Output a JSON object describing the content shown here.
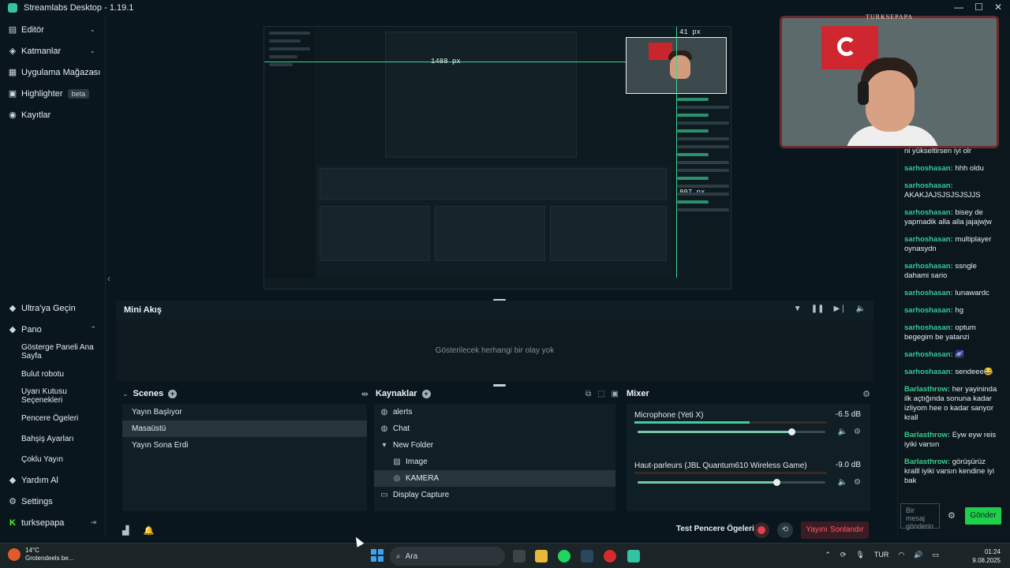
{
  "window": {
    "title": "Streamlabs Desktop - 1.19.1",
    "app_icon": "streamlabs-logo-icon",
    "controls": [
      "—",
      "☐",
      "✕"
    ]
  },
  "sidebar": {
    "top_items": [
      {
        "label": "Editör",
        "icon": "editor-icon",
        "expandable": true
      },
      {
        "label": "Katmanlar",
        "icon": "layers-icon",
        "expandable": true
      },
      {
        "label": "Uygulama Mağazası",
        "icon": "store-icon",
        "expandable": true
      },
      {
        "label": "Highlighter",
        "icon": "highlighter-icon",
        "badge": "beta"
      },
      {
        "label": "Kayıtlar",
        "icon": "record-icon"
      }
    ],
    "bottom_items": {
      "ultra": "Ultra'ya Geçin",
      "dashboard": "Pano",
      "dashboard_sub": [
        "Gösterge Paneli Ana Sayfa",
        "Bulut robotu",
        "Uyarı Kutusu Seçenekleri",
        "Pencere Ögeleri",
        "Bahşiş Ayarları",
        "Çoklu Yayın"
      ],
      "help": "Yardım Al",
      "settings": "Settings",
      "user": "turksepapa"
    }
  },
  "preview": {
    "width_label": "1488 px",
    "cam_label": "41 px",
    "chat_label": "807 px"
  },
  "mini_feed": {
    "title": "Mini Akış",
    "empty": "Gösterilecek herhangi bir olay yok"
  },
  "scenes": {
    "title": "Scenes",
    "items": [
      {
        "label": "Yayın Başlıyor",
        "selected": false
      },
      {
        "label": "Masaüstü",
        "selected": true
      },
      {
        "label": "Yayın Sona Erdi",
        "selected": false
      }
    ]
  },
  "sources": {
    "title": "Kaynaklar",
    "items": [
      {
        "label": "alerts",
        "icon": "globe-icon",
        "indent": 0
      },
      {
        "label": "Chat",
        "icon": "globe-icon",
        "indent": 0
      },
      {
        "label": "New Folder",
        "icon": "folder-icon",
        "indent": 0
      },
      {
        "label": "Image",
        "icon": "image-icon",
        "indent": 1
      },
      {
        "label": "KAMERA",
        "icon": "camera-icon",
        "indent": 1,
        "selected": true
      },
      {
        "label": "Display Capture",
        "icon": "monitor-icon",
        "indent": 0
      }
    ]
  },
  "mixer": {
    "title": "Mixer",
    "channels": [
      {
        "name": "Microphone (Yeti X)",
        "db": "-6.5 dB",
        "level": 0.6,
        "volume": 0.82
      },
      {
        "name": "Haut-parleurs (JBL Quantum610 Wireless Game)",
        "db": "-9.0 dB",
        "level": 0.0,
        "volume": 0.74
      }
    ]
  },
  "bottom_bar": {
    "test_widgets": "Test Pencere Ögeleri",
    "end_stream": "Yayını Sonlandır"
  },
  "webcam": {
    "frame_tag": "TURKSEPAPA"
  },
  "chat": {
    "messages": [
      {
        "user": "",
        "text": "ni yükseltirsen iyi olr",
        "color": "teal"
      },
      {
        "user": "sarhoshasan:",
        "text": "hhh oldu",
        "color": "teal"
      },
      {
        "user": "sarhoshasan:",
        "text": "AKAKJAJSJSJSJSJJS",
        "color": "teal"
      },
      {
        "user": "sarhoshasan:",
        "text": "bisey de yapmadik alla alla jajajwjw",
        "color": "teal"
      },
      {
        "user": "sarhoshasan:",
        "text": "multiplayer oynasydn",
        "color": "teal"
      },
      {
        "user": "sarhoshasan:",
        "text": "ssngle dahami sario",
        "color": "teal"
      },
      {
        "user": "sarhoshasan:",
        "text": "lunawardc",
        "color": "teal"
      },
      {
        "user": "sarhoshasan:",
        "text": "hg",
        "color": "teal"
      },
      {
        "user": "sarhoshasan:",
        "text": "optum begegim be yatanzi",
        "color": "teal"
      },
      {
        "user": "sarhoshasan:",
        "text": "🌌",
        "color": "teal"
      },
      {
        "user": "sarhoshasan:",
        "text": "sendeee😂",
        "color": "teal"
      },
      {
        "user": "Barlasthrow:",
        "text": "her yayininda ilk açtığında sonuna kadar izliyom hee o kadar sanyor krall",
        "color": "green"
      },
      {
        "user": "Barlasthrow:",
        "text": "Eyw eyw reis iyiki varsın",
        "color": "green"
      },
      {
        "user": "Barlasthrow:",
        "text": "görüşürüz kralll iyiki varsın kendine iyi bak",
        "color": "green"
      }
    ],
    "input_placeholder": "Bir mesaj gönderin",
    "send": "Gönder"
  },
  "taskbar": {
    "weather_temp": "14°C",
    "weather_desc": "Grotendeels be...",
    "search": "Ara",
    "lang": "TUR",
    "time": "01:24",
    "date": "9.08.2025"
  },
  "colors": {
    "accent": "#31c3a2",
    "end_stream": "#ff5a6c",
    "send": "#1fce4d",
    "chat_user": "#35c99e"
  }
}
